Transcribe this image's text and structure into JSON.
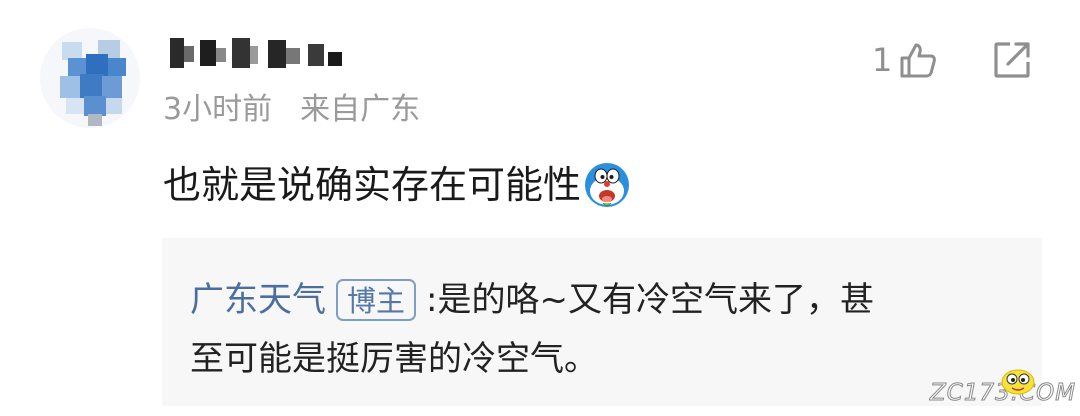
{
  "comment": {
    "time": "3小时前",
    "location": "来自广东",
    "text": "也就是说确实存在可能性",
    "emoji": "doraemon-emoji",
    "like_count": "1",
    "icons": {
      "like": "thumbs-up-icon",
      "share": "share-icon"
    }
  },
  "reply": {
    "author": "广东天气",
    "badge": "博主",
    "colon": ":",
    "line1": "是的咯~又有冷空气来了，甚",
    "line2": "至可能是挺厉害的冷空气。"
  },
  "watermark": {
    "text": "ZC173.COM"
  },
  "colors": {
    "author_link": "#4a6f9e",
    "badge_border": "#7f9ec6",
    "meta_gray": "#9a9a9a",
    "reply_bg": "#f7f7f8",
    "text": "#1a1a1a"
  }
}
